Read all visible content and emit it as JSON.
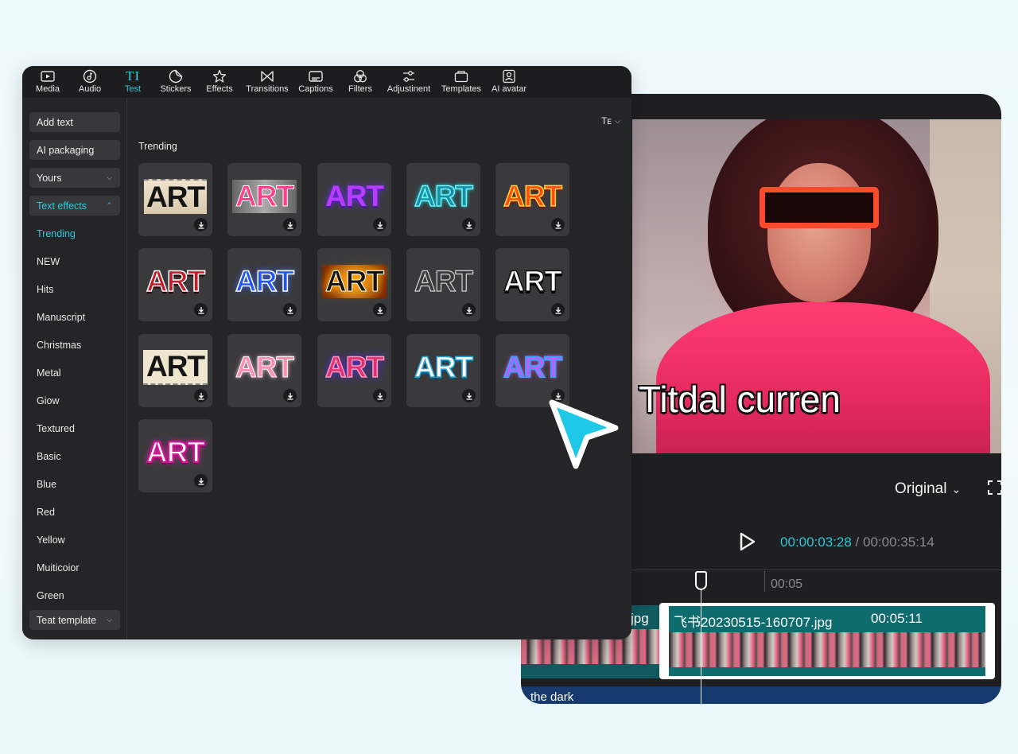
{
  "toolbar": {
    "tools": [
      {
        "label": "Media",
        "icon": "media-icon"
      },
      {
        "label": "Audio",
        "icon": "audio-icon"
      },
      {
        "label": "Test",
        "icon": "text-icon"
      },
      {
        "label": "Stickers",
        "icon": "stickers-icon"
      },
      {
        "label": "Effects",
        "icon": "effects-icon"
      },
      {
        "label": "Transitions",
        "icon": "transitions-icon"
      },
      {
        "label": "Captions",
        "icon": "captions-icon"
      },
      {
        "label": "Filters",
        "icon": "filters-icon"
      },
      {
        "label": "Adjustinent",
        "icon": "adjustment-icon"
      },
      {
        "label": "Templates",
        "icon": "templates-icon"
      },
      {
        "label": "AI avatar",
        "icon": "ai-avatar-icon"
      }
    ],
    "active_color": "#2ec9dd"
  },
  "sidebar": {
    "add_text": "Add text",
    "ai_packaging": "AI packaging",
    "yours": "Yours",
    "text_effects": "Text effects",
    "items": [
      "Trending",
      "NEW",
      "Hits",
      "Manuscript",
      "Christmas",
      "Metal",
      "Giow",
      "Textured",
      "Basic",
      "Blue",
      "Red",
      "Yellow",
      "Muiticoior",
      "Green"
    ],
    "text_template": "Teat template"
  },
  "content": {
    "font_switch": "Tᴇ",
    "section_title": "Trending",
    "card_text": "ART",
    "card_count": 16
  },
  "preview": {
    "caption": "Titdal curren",
    "ratio": "Original",
    "current_time": "00:00:03:28",
    "separator": "/",
    "total_time": "00:00:35:14",
    "ruler_label": "00:05",
    "prev_clip_label": "jpg",
    "main_clip_label": "飞书20230515-160707.jpg",
    "main_clip_duration": "00:05:11",
    "audio_label": "the dark"
  },
  "colors": {
    "accent": "#2ec9dd",
    "panel_bg": "#252527",
    "clip_bg": "#0e6b6e",
    "cursor": "#1ec8e6"
  }
}
